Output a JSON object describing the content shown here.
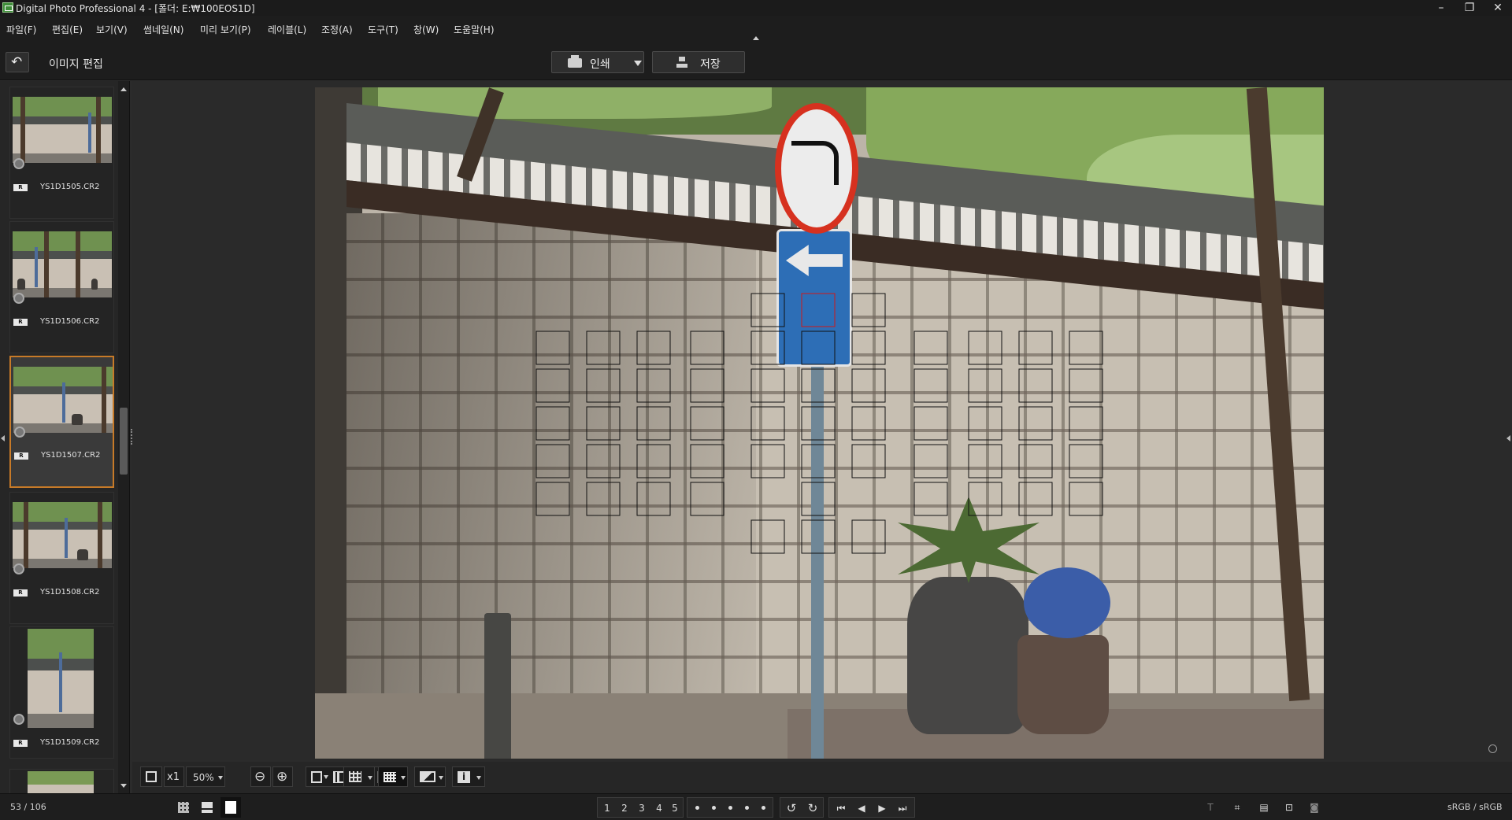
{
  "window": {
    "title": "Digital Photo Professional 4 - [폴더: E:₩100EOS1D]",
    "minimize_glyph": "–",
    "restore_glyph": "❐",
    "close_glyph": "✕"
  },
  "menu": {
    "items": [
      "파일(F)",
      "편집(E)",
      "보기(V)",
      "썸네일(N)",
      "미리 보기(P)",
      "레이블(L)",
      "조정(A)",
      "도구(T)",
      "창(W)",
      "도움말(H)"
    ]
  },
  "toolbar": {
    "back_glyph": "↶",
    "mode_title": "이미지 편집",
    "print_label": "인쇄",
    "save_label": "저장"
  },
  "filmstrip": {
    "items": [
      {
        "filename": "YS1D1505.CR2",
        "raw": "R",
        "selected": false
      },
      {
        "filename": "YS1D1506.CR2",
        "raw": "R",
        "selected": false
      },
      {
        "filename": "YS1D1507.CR2",
        "raw": "R",
        "selected": true
      },
      {
        "filename": "YS1D1508.CR2",
        "raw": "R",
        "selected": false
      },
      {
        "filename": "YS1D1509.CR2",
        "raw": "R",
        "selected": false
      }
    ]
  },
  "viewer": {
    "zoom_x1": "x1",
    "zoom_level": "50%",
    "zoom_out_glyph": "⊖",
    "zoom_in_glyph": "⊕",
    "info_glyph": "i",
    "af_points_active_color": "#d01818"
  },
  "status": {
    "count": "53 / 106",
    "rating_labels": [
      "1",
      "2",
      "3",
      "4",
      "5"
    ],
    "color_space": "sRGB / sRGB"
  },
  "colors": {
    "selection_border": "#c77a28",
    "background": "#2a2a2a"
  }
}
